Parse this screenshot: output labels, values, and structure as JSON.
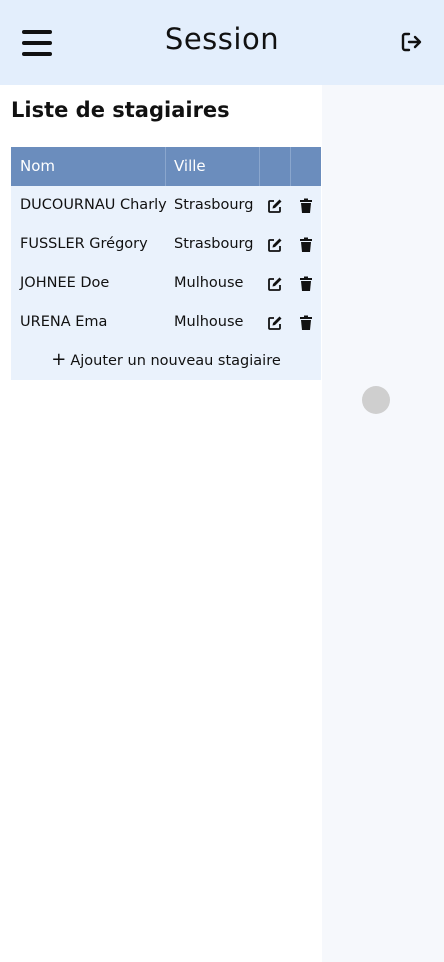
{
  "header": {
    "title": "Session",
    "menu_icon": "hamburger-menu-icon",
    "logout_icon": "logout-icon"
  },
  "section": {
    "title": "Liste de stagiaires"
  },
  "table": {
    "columns": [
      "Nom",
      "Ville"
    ],
    "rows": [
      {
        "nom": "DUCOURNAU Charly",
        "ville": "Strasbourg"
      },
      {
        "nom": "FUSSLER Grégory",
        "ville": "Strasbourg"
      },
      {
        "nom": "JOHNEE Doe",
        "ville": "Mulhouse"
      },
      {
        "nom": "URENA Ema",
        "ville": "Mulhouse"
      }
    ],
    "add_label": "Ajouter un nouveau stagiaire",
    "add_icon": "plus-icon",
    "edit_icon": "edit-icon",
    "delete_icon": "trash-icon"
  },
  "colors": {
    "header_bg": "#e3eefc",
    "table_header_bg": "#6b8dbd",
    "table_body_bg": "#eaf2fc"
  }
}
